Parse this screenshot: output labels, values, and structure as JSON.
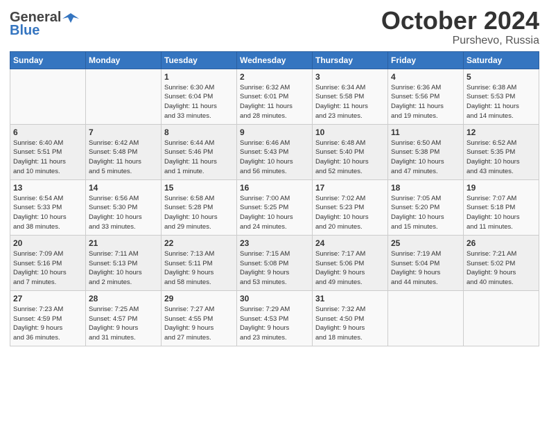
{
  "header": {
    "logo_general": "General",
    "logo_blue": "Blue",
    "month": "October 2024",
    "location": "Purshevo, Russia"
  },
  "days_of_week": [
    "Sunday",
    "Monday",
    "Tuesday",
    "Wednesday",
    "Thursday",
    "Friday",
    "Saturday"
  ],
  "weeks": [
    [
      {
        "day": "",
        "info": ""
      },
      {
        "day": "",
        "info": ""
      },
      {
        "day": "1",
        "info": "Sunrise: 6:30 AM\nSunset: 6:04 PM\nDaylight: 11 hours\nand 33 minutes."
      },
      {
        "day": "2",
        "info": "Sunrise: 6:32 AM\nSunset: 6:01 PM\nDaylight: 11 hours\nand 28 minutes."
      },
      {
        "day": "3",
        "info": "Sunrise: 6:34 AM\nSunset: 5:58 PM\nDaylight: 11 hours\nand 23 minutes."
      },
      {
        "day": "4",
        "info": "Sunrise: 6:36 AM\nSunset: 5:56 PM\nDaylight: 11 hours\nand 19 minutes."
      },
      {
        "day": "5",
        "info": "Sunrise: 6:38 AM\nSunset: 5:53 PM\nDaylight: 11 hours\nand 14 minutes."
      }
    ],
    [
      {
        "day": "6",
        "info": "Sunrise: 6:40 AM\nSunset: 5:51 PM\nDaylight: 11 hours\nand 10 minutes."
      },
      {
        "day": "7",
        "info": "Sunrise: 6:42 AM\nSunset: 5:48 PM\nDaylight: 11 hours\nand 5 minutes."
      },
      {
        "day": "8",
        "info": "Sunrise: 6:44 AM\nSunset: 5:46 PM\nDaylight: 11 hours\nand 1 minute."
      },
      {
        "day": "9",
        "info": "Sunrise: 6:46 AM\nSunset: 5:43 PM\nDaylight: 10 hours\nand 56 minutes."
      },
      {
        "day": "10",
        "info": "Sunrise: 6:48 AM\nSunset: 5:40 PM\nDaylight: 10 hours\nand 52 minutes."
      },
      {
        "day": "11",
        "info": "Sunrise: 6:50 AM\nSunset: 5:38 PM\nDaylight: 10 hours\nand 47 minutes."
      },
      {
        "day": "12",
        "info": "Sunrise: 6:52 AM\nSunset: 5:35 PM\nDaylight: 10 hours\nand 43 minutes."
      }
    ],
    [
      {
        "day": "13",
        "info": "Sunrise: 6:54 AM\nSunset: 5:33 PM\nDaylight: 10 hours\nand 38 minutes."
      },
      {
        "day": "14",
        "info": "Sunrise: 6:56 AM\nSunset: 5:30 PM\nDaylight: 10 hours\nand 33 minutes."
      },
      {
        "day": "15",
        "info": "Sunrise: 6:58 AM\nSunset: 5:28 PM\nDaylight: 10 hours\nand 29 minutes."
      },
      {
        "day": "16",
        "info": "Sunrise: 7:00 AM\nSunset: 5:25 PM\nDaylight: 10 hours\nand 24 minutes."
      },
      {
        "day": "17",
        "info": "Sunrise: 7:02 AM\nSunset: 5:23 PM\nDaylight: 10 hours\nand 20 minutes."
      },
      {
        "day": "18",
        "info": "Sunrise: 7:05 AM\nSunset: 5:20 PM\nDaylight: 10 hours\nand 15 minutes."
      },
      {
        "day": "19",
        "info": "Sunrise: 7:07 AM\nSunset: 5:18 PM\nDaylight: 10 hours\nand 11 minutes."
      }
    ],
    [
      {
        "day": "20",
        "info": "Sunrise: 7:09 AM\nSunset: 5:16 PM\nDaylight: 10 hours\nand 7 minutes."
      },
      {
        "day": "21",
        "info": "Sunrise: 7:11 AM\nSunset: 5:13 PM\nDaylight: 10 hours\nand 2 minutes."
      },
      {
        "day": "22",
        "info": "Sunrise: 7:13 AM\nSunset: 5:11 PM\nDaylight: 9 hours\nand 58 minutes."
      },
      {
        "day": "23",
        "info": "Sunrise: 7:15 AM\nSunset: 5:08 PM\nDaylight: 9 hours\nand 53 minutes."
      },
      {
        "day": "24",
        "info": "Sunrise: 7:17 AM\nSunset: 5:06 PM\nDaylight: 9 hours\nand 49 minutes."
      },
      {
        "day": "25",
        "info": "Sunrise: 7:19 AM\nSunset: 5:04 PM\nDaylight: 9 hours\nand 44 minutes."
      },
      {
        "day": "26",
        "info": "Sunrise: 7:21 AM\nSunset: 5:02 PM\nDaylight: 9 hours\nand 40 minutes."
      }
    ],
    [
      {
        "day": "27",
        "info": "Sunrise: 7:23 AM\nSunset: 4:59 PM\nDaylight: 9 hours\nand 36 minutes."
      },
      {
        "day": "28",
        "info": "Sunrise: 7:25 AM\nSunset: 4:57 PM\nDaylight: 9 hours\nand 31 minutes."
      },
      {
        "day": "29",
        "info": "Sunrise: 7:27 AM\nSunset: 4:55 PM\nDaylight: 9 hours\nand 27 minutes."
      },
      {
        "day": "30",
        "info": "Sunrise: 7:29 AM\nSunset: 4:53 PM\nDaylight: 9 hours\nand 23 minutes."
      },
      {
        "day": "31",
        "info": "Sunrise: 7:32 AM\nSunset: 4:50 PM\nDaylight: 9 hours\nand 18 minutes."
      },
      {
        "day": "",
        "info": ""
      },
      {
        "day": "",
        "info": ""
      }
    ]
  ]
}
